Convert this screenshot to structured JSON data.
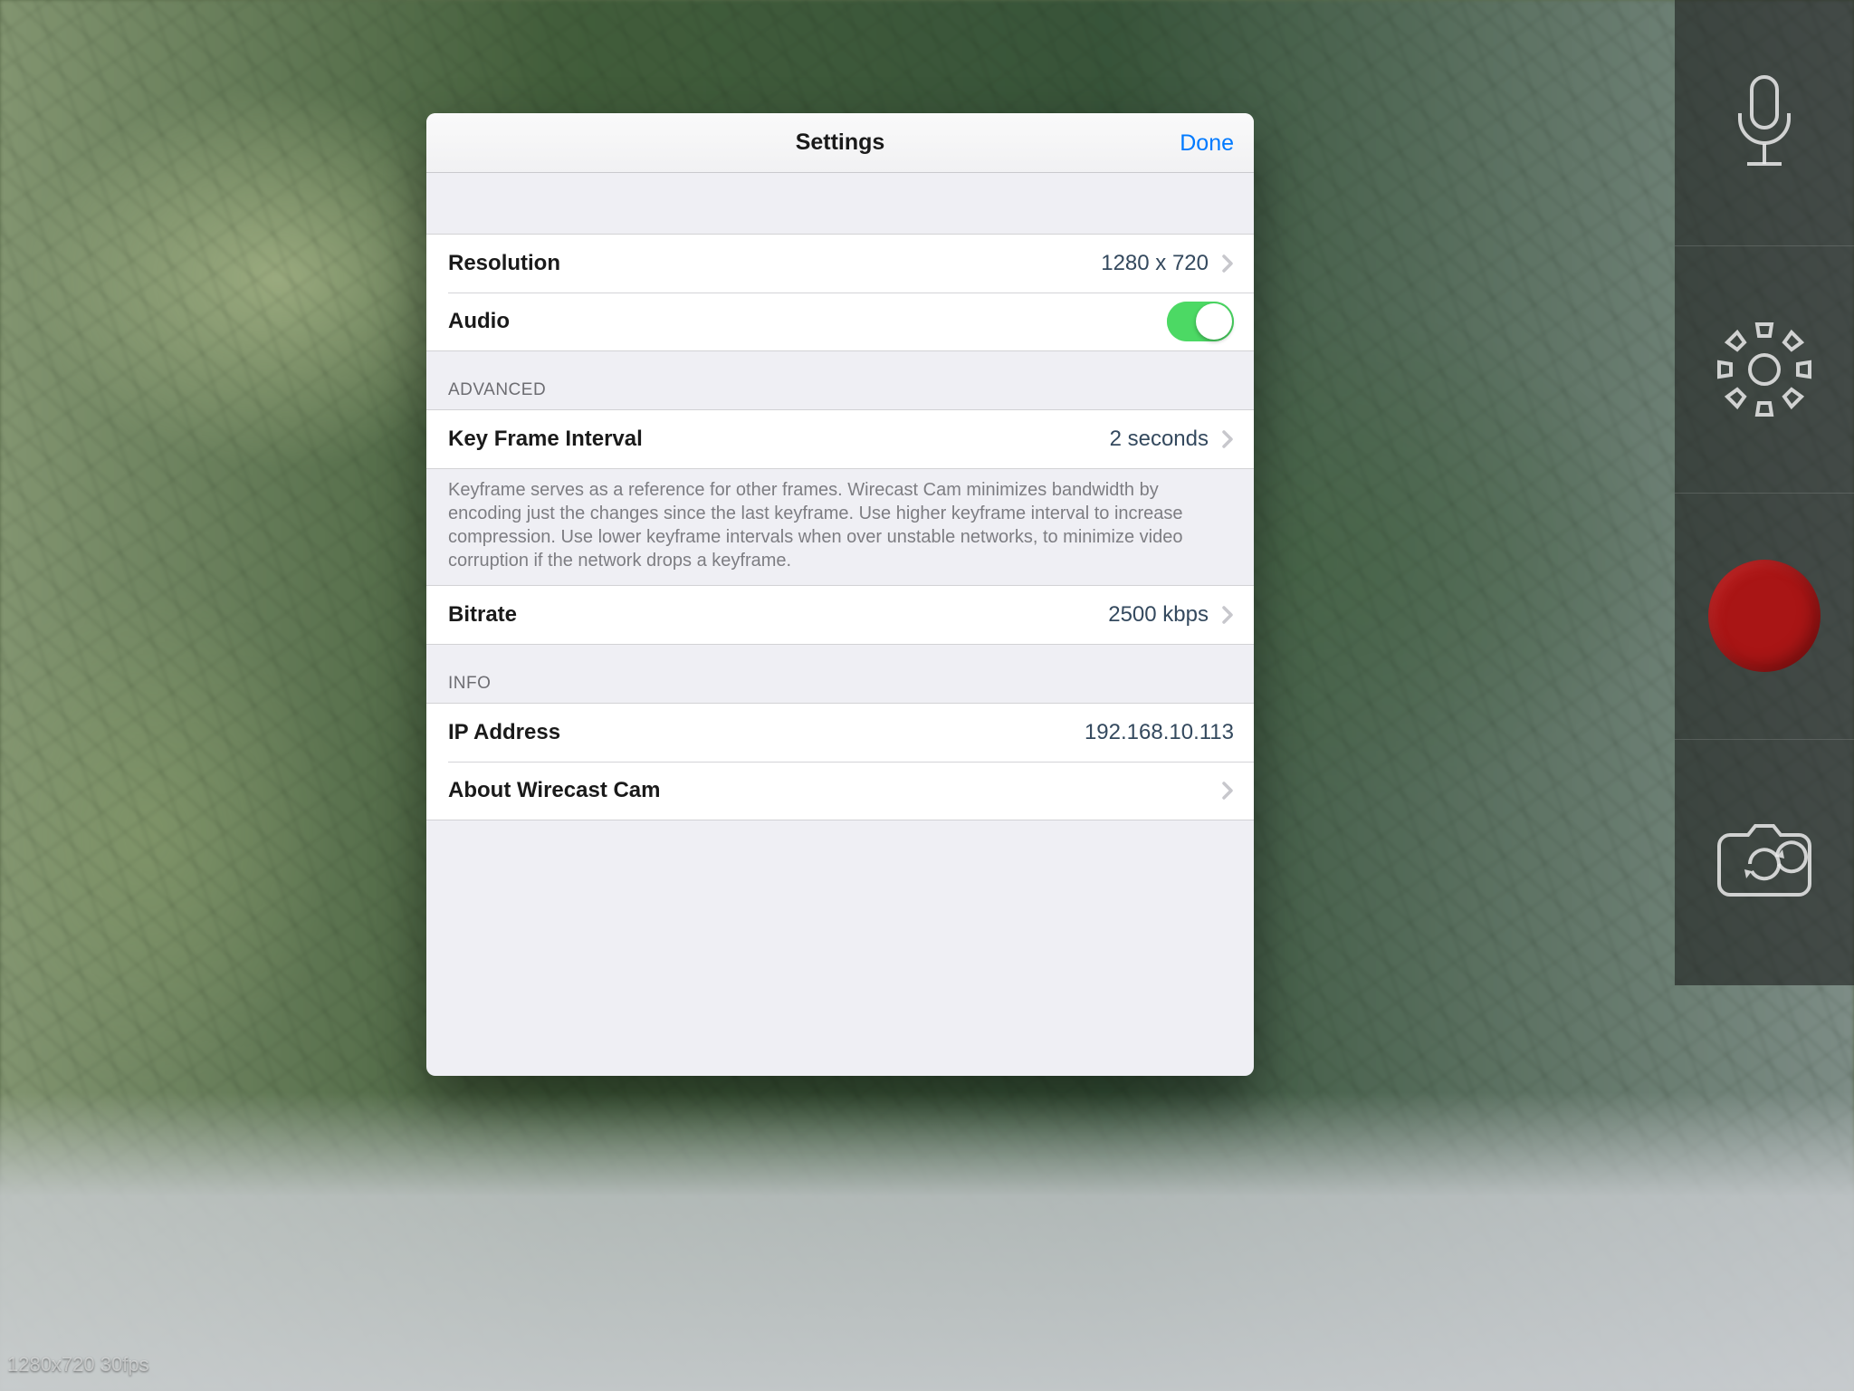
{
  "panel": {
    "title": "Settings",
    "done": "Done",
    "sections": {
      "top": {
        "resolution": {
          "label": "Resolution",
          "value": "1280 x 720"
        },
        "audio": {
          "label": "Audio",
          "on": true
        }
      },
      "advanced": {
        "header": "ADVANCED",
        "keyframe": {
          "label": "Key Frame Interval",
          "value": "2 seconds"
        },
        "keyframe_note": "Keyframe serves as a reference for other frames. Wirecast Cam minimizes bandwidth by encoding just the changes since the last keyframe. Use higher keyframe interval to increase compression.  Use lower keyframe intervals when over unstable networks, to minimize video corruption if the network drops a keyframe.",
        "bitrate": {
          "label": "Bitrate",
          "value": "2500 kbps"
        }
      },
      "info": {
        "header": "INFO",
        "ip": {
          "label": "IP Address",
          "value": "192.168.10.113"
        },
        "about": {
          "label": "About Wirecast Cam"
        }
      }
    }
  },
  "overlay": {
    "status": "1280x720 30fps"
  }
}
